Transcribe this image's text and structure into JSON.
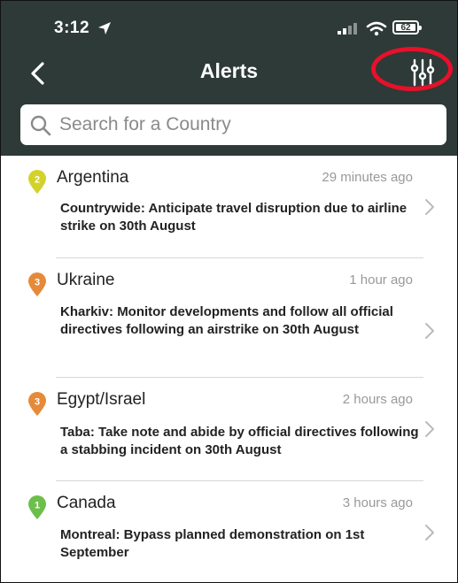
{
  "status_bar": {
    "time": "3:12",
    "battery": "62"
  },
  "header": {
    "title": "Alerts"
  },
  "search": {
    "placeholder": "Search for a Country"
  },
  "colors": {
    "header_bg": "#2e3a37",
    "pin_yellow": "#d3d22a",
    "pin_orange": "#e58a3a",
    "pin_green": "#6cbf4a",
    "highlight": "#e8102a"
  },
  "alerts": [
    {
      "level": "2",
      "pin_color": "#d3d22a",
      "country": "Argentina",
      "time": "29 minutes ago",
      "description": "Countrywide: Anticipate travel disruption due to airline strike on 30th August"
    },
    {
      "level": "3",
      "pin_color": "#e58a3a",
      "country": "Ukraine",
      "time": "1 hour ago",
      "description": "Kharkiv: Monitor developments and follow all official directives following an airstrike on 30th August"
    },
    {
      "level": "3",
      "pin_color": "#e58a3a",
      "country": "Egypt/Israel",
      "time": "2 hours ago",
      "description": "Taba: Take note and abide by official directives following a stabbing incident on 30th August"
    },
    {
      "level": "1",
      "pin_color": "#6cbf4a",
      "country": "Canada",
      "time": "3 hours ago",
      "description": "Montreal: Bypass planned demonstration on 1st September"
    }
  ]
}
